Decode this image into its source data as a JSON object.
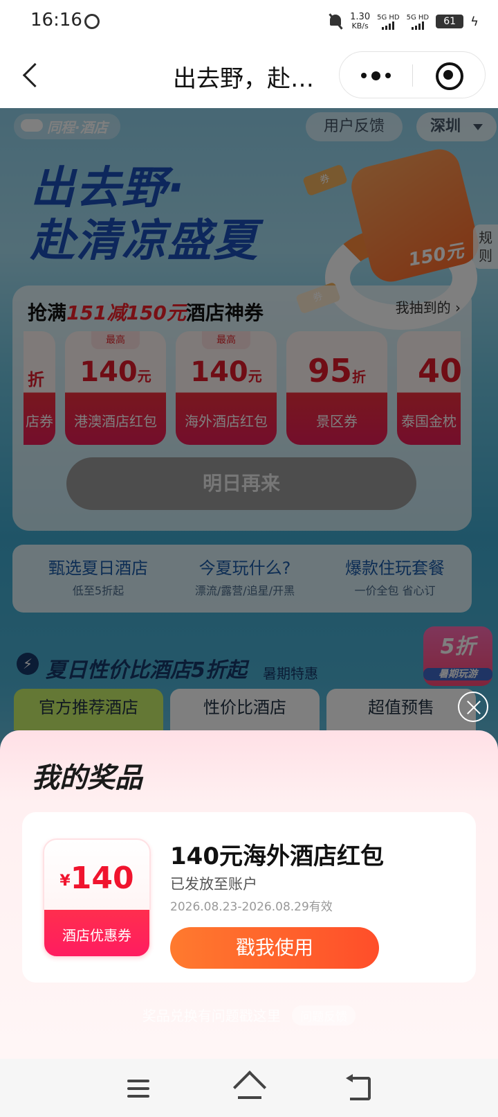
{
  "status_bar": {
    "time": "16:16",
    "net_speed_value": "1.30",
    "net_speed_unit": "KB/s",
    "sim1": "5G HD",
    "sim2": "5G HD",
    "battery": "61"
  },
  "title_bar": {
    "title": "出去野，赴…"
  },
  "background_page": {
    "brand": "同程·酒店",
    "feedback": "用户反馈",
    "city": "深圳",
    "hero_line1": "出去野·",
    "hero_line2": "赴清凉盛夏",
    "bag_value": "150元",
    "ticket1": "券",
    "ticket2": "券",
    "rules": "规则",
    "coupon_head_prefix": "抢满",
    "coupon_head_highlight": "151减150元",
    "coupon_head_suffix": "酒店神券",
    "mine_link": "我抽到的 ›",
    "coupons": [
      {
        "tag": "",
        "amount": "折",
        "unit": "",
        "name": "店券"
      },
      {
        "tag": "最高",
        "amount": "140",
        "unit": "元",
        "name": "港澳酒店红包"
      },
      {
        "tag": "最高",
        "amount": "140",
        "unit": "元",
        "name": "海外酒店红包"
      },
      {
        "tag": "",
        "amount": "95",
        "unit": "折",
        "name": "景区券"
      },
      {
        "tag": "",
        "amount": "40",
        "unit": "",
        "name": "泰国金枕"
      }
    ],
    "tomorrow_btn": "明日再来",
    "entries": [
      {
        "title": "甄选夏日酒店",
        "sub": "低至5折起"
      },
      {
        "title": "今夏玩什么?",
        "sub": "漂流/露营/追星/开黑"
      },
      {
        "title": "爆款住玩套餐",
        "sub": "一价全包 省心订"
      }
    ],
    "section_title": "夏日性价比酒店5折起",
    "section_sub": "暑期特惠",
    "badge_main": "5折",
    "badge_sub": "暑期玩游",
    "tabs": [
      "官方推荐酒店",
      "性价比酒店",
      "超值预售"
    ]
  },
  "prize_sheet": {
    "title": "我的奖品",
    "voucher_currency": "¥",
    "voucher_amount": "140",
    "voucher_label": "酒店优惠券",
    "prize_name": "140元海外酒店红包",
    "prize_status": "已发放至账户",
    "prize_valid": "2026.08.23-2026.08.29有效",
    "use_button": "戳我使用",
    "help_text": "奖品兑换有问题戳这里",
    "help_chip": "问题反馈"
  },
  "colors": {
    "accent_red": "#f0142e",
    "button_orange": "#ff5e2c",
    "hero_blue": "#1b4fb8"
  }
}
